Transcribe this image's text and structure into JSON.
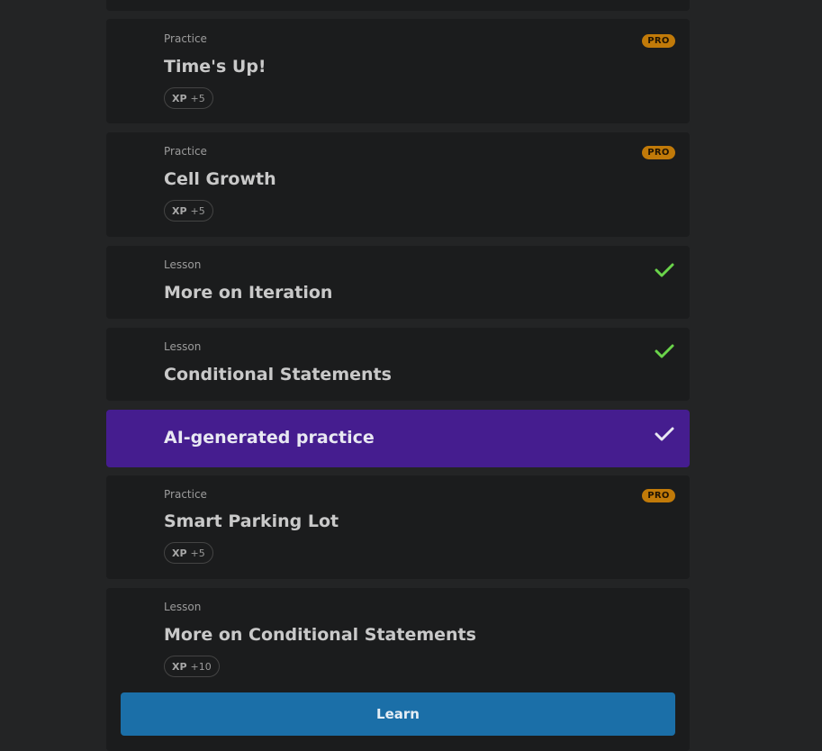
{
  "items": [
    {
      "kind": "Practice",
      "title": "Time's Up!",
      "xp_label": "XP",
      "xp_value": "+5",
      "badge": "PRO"
    },
    {
      "kind": "Practice",
      "title": "Cell Growth",
      "xp_label": "XP",
      "xp_value": "+5",
      "badge": "PRO"
    },
    {
      "kind": "Lesson",
      "title": "More on Iteration",
      "status_icon": "check-icon",
      "status": "completed"
    },
    {
      "kind": "Lesson",
      "title": "Conditional Statements",
      "status_icon": "check-icon",
      "status": "completed"
    },
    {
      "title": "AI-generated practice",
      "status_icon": "check-icon",
      "status": "completed"
    },
    {
      "kind": "Practice",
      "title": "Smart Parking Lot",
      "xp_label": "XP",
      "xp_value": "+5",
      "badge": "PRO"
    },
    {
      "kind": "Lesson",
      "title": "More on Conditional Statements",
      "xp_label": "XP",
      "xp_value": "+10"
    }
  ],
  "learn_button": "Learn",
  "colors": {
    "page_bg": "#232425",
    "card_bg": "#1b1c1d",
    "active_card_bg": "#451d8f",
    "pro_badge": "#c17a09",
    "check_green": "#6ad44a",
    "learn_button": "#1b6fa8"
  }
}
